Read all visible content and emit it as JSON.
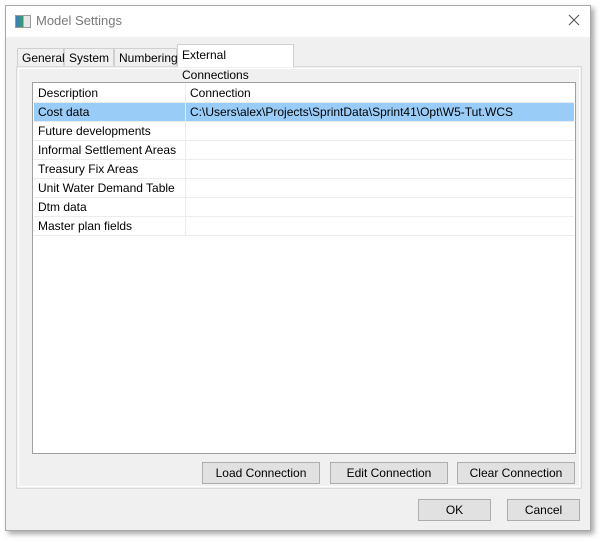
{
  "window": {
    "title": "Model Settings",
    "icon": "app-window-icon",
    "close_icon": "close-icon"
  },
  "tabs": [
    {
      "label": "General",
      "active": false
    },
    {
      "label": "System",
      "active": false
    },
    {
      "label": "Numbering",
      "active": false
    },
    {
      "label": "External Connections",
      "active": true
    }
  ],
  "table": {
    "columns": [
      "Description",
      "Connection"
    ],
    "rows": [
      {
        "description": "Cost data",
        "connection": "C:\\Users\\alex\\Projects\\SprintData\\Sprint41\\Opt\\W5-Tut.WCS",
        "selected": true
      },
      {
        "description": "Future developments",
        "connection": ""
      },
      {
        "description": "Informal Settlement Areas",
        "connection": ""
      },
      {
        "description": "Treasury Fix Areas",
        "connection": ""
      },
      {
        "description": "Unit Water Demand Table",
        "connection": ""
      },
      {
        "description": "Dtm data",
        "connection": ""
      },
      {
        "description": "Master plan fields",
        "connection": ""
      }
    ]
  },
  "actions": {
    "load": "Load Connection",
    "edit": "Edit Connection",
    "clear": "Clear Connection"
  },
  "dialog_buttons": {
    "ok": "OK",
    "cancel": "Cancel"
  },
  "colors": {
    "selection": "#99ccf6"
  }
}
